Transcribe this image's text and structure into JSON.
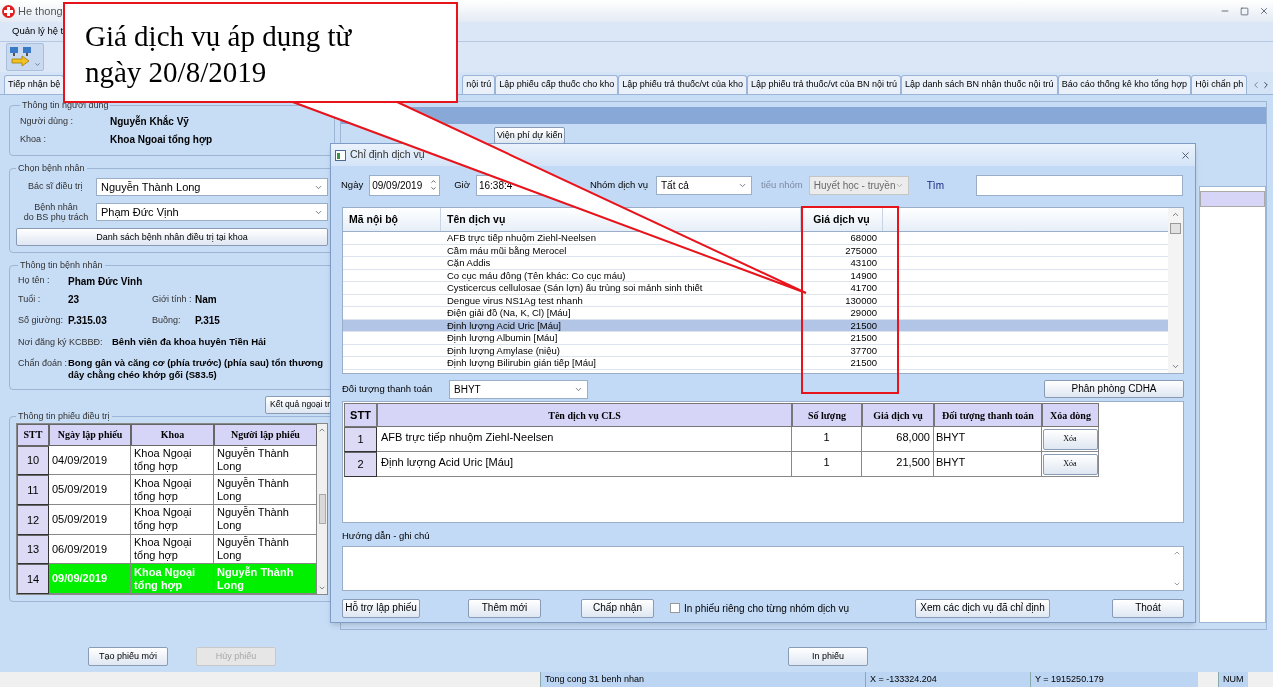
{
  "window": {
    "title": "He thong"
  },
  "menu": [
    "Quản lý hệ t"
  ],
  "tabs": [
    {
      "label": "Tiếp nhận bệ",
      "selected": false
    },
    {
      "label": "nội trú",
      "selected": false
    },
    {
      "label": "Lập phiếu cấp thuốc cho kho",
      "selected": false
    },
    {
      "label": "Lập phiếu trả thuốc/vt của kho",
      "selected": false
    },
    {
      "label": "Lập phiếu trả thuốc/vt của BN nội trú",
      "selected": false
    },
    {
      "label": "Lập danh sách BN nhận thuốc nội trú",
      "selected": false
    },
    {
      "label": "Báo cáo thống kê kho tổng hợp",
      "selected": false
    },
    {
      "label": "Hội chẩn ph",
      "selected": false
    }
  ],
  "callout": {
    "text": "Giá dịch vụ áp dụng từ ngày 20/8/2019"
  },
  "user_info": {
    "title": "Thông tin người dùng",
    "fields": [
      {
        "label": "Người dùng :",
        "value": "Nguyễn Khắc Vỹ"
      },
      {
        "label": "Khoa :",
        "value": "Khoa Ngoai tổng hợp"
      }
    ]
  },
  "patient_select": {
    "title": "Chọn bệnh nhân",
    "doctor": {
      "label": "Bác sĩ điều trị",
      "value": "Nguyễn Thành Long"
    },
    "patient": {
      "label": "Bệnh nhân\ndo BS phụ trách",
      "value": "Phạm Đức Vịnh"
    },
    "list_button": "Danh sách bệnh nhân điều trị tại khoa"
  },
  "patient_info": {
    "title": "Thông tin bệnh nhân",
    "name": {
      "label": "Họ tên :",
      "value": "Pham Đức Vinh"
    },
    "age": {
      "label": "Tuổi :",
      "value": "23"
    },
    "sex": {
      "label": "Giới tính :",
      "value": "Nam"
    },
    "bed": {
      "label": "Số giường:",
      "value": "P.315.03"
    },
    "room": {
      "label": "Buồng:",
      "value": "P.315"
    },
    "registration": {
      "label": "Nơi đăng ký KCBBĐ:",
      "value": "Bênh viên đa khoa huyên Tiền Hải"
    },
    "diagnosis": {
      "label": "Chẩn đoán :",
      "value": "Bong gân và căng cơ (phía trước) (phía sau) tổn thương dây chằng chéo khớp gối (S83.5)"
    }
  },
  "results_button": "Kết quả ngoại tr",
  "treatment_sheets": {
    "title": "Thông tin phiếu điều trị",
    "columns": [
      "STT",
      "Ngày lập phiếu",
      "Khoa",
      "Người lập phiếu"
    ],
    "rows": [
      {
        "stt": "10",
        "date": "04/09/2019",
        "dept": "Khoa Ngoại tổng hợp",
        "author": "Nguyễn Thành Long",
        "selected": false
      },
      {
        "stt": "11",
        "date": "05/09/2019",
        "dept": "Khoa Ngoại tổng hợp",
        "author": "Nguyễn Thành Long",
        "selected": false
      },
      {
        "stt": "12",
        "date": "05/09/2019",
        "dept": "Khoa Ngoại tổng hợp",
        "author": "Nguyễn Thành Long",
        "selected": false
      },
      {
        "stt": "13",
        "date": "06/09/2019",
        "dept": "Khoa Ngoại tổng hợp",
        "author": "Nguyễn Thành Long",
        "selected": false
      },
      {
        "stt": "14",
        "date": "09/09/2019",
        "dept": "Khoa Ngoại tổng hợp",
        "author": "Nguyễn Thành Long",
        "selected": true
      }
    ]
  },
  "bottom_buttons": [
    {
      "label": "Tạo phiếu mới",
      "disabled": false
    },
    {
      "label": "Hủy phiếu",
      "disabled": true
    }
  ],
  "print_button": "In phiếu",
  "estimate_button": "Viện phí dự kiến",
  "dialog": {
    "title": "Chỉ định dịch vụ",
    "date": {
      "label": "Ngày",
      "value": "09/09/2019"
    },
    "time": {
      "label": "Giờ",
      "value": "16:38:4"
    },
    "group": {
      "label": "Nhóm dịch vụ",
      "value": "Tất cả"
    },
    "subgroup": {
      "label": "tiểu nhóm",
      "value": "Huyết học - truyền",
      "disabled": true
    },
    "search": {
      "label": "Tìm"
    },
    "services": {
      "columns": [
        "Mã nội bộ",
        "Tên dịch vụ",
        "Giá dịch vụ"
      ],
      "rows": [
        {
          "name": "AFB trực tiếp nhuộm Ziehl-Neelsen",
          "price": "68000",
          "selected": false
        },
        {
          "name": "Cầm máu mũi bằng Merocel",
          "price": "275000",
          "selected": false
        },
        {
          "name": "Cặn Addis",
          "price": "43100",
          "selected": false
        },
        {
          "name": "Co cục máu đông (Tên khác: Co cục máu)",
          "price": "14900",
          "selected": false
        },
        {
          "name": "Cysticercus cellulosae (Sán lợn) ấu trùng soi mảnh sinh thiết",
          "price": "41700",
          "selected": false
        },
        {
          "name": "Dengue virus NS1Ag test nhanh",
          "price": "130000",
          "selected": false
        },
        {
          "name": "Điện giải đồ (Na, K, Cl) [Máu]",
          "price": "29000",
          "selected": false
        },
        {
          "name": "Định lượng Acid Uric [Máu]",
          "price": "21500",
          "selected": true
        },
        {
          "name": "Định lượng Albumin [Máu]",
          "price": "21500",
          "selected": false
        },
        {
          "name": "Định lượng Amylase (niệu)",
          "price": "37700",
          "selected": false
        },
        {
          "name": "Định lượng Bilirubin gián tiếp [Máu]",
          "price": "21500",
          "selected": false
        }
      ]
    },
    "payer": {
      "label": "Đối tượng thanh toán",
      "value": "BHYT"
    },
    "cdha_button": "Phân phòng CDHA",
    "chosen": {
      "columns": [
        "STT",
        "Tên dịch vụ CLS",
        "Số lượng",
        "Giá dịch vụ",
        "Đối tượng thanh toán",
        "Xóa dòng"
      ],
      "rows": [
        {
          "stt": "1",
          "name": "AFB trực tiếp nhuộm Ziehl-Neelsen",
          "qty": "1",
          "price": "68,000",
          "payer": "BHYT",
          "action": "Xóa"
        },
        {
          "stt": "2",
          "name": "Định lượng Acid Uric [Máu]",
          "qty": "1",
          "price": "21,500",
          "payer": "BHYT",
          "action": "Xóa"
        }
      ]
    },
    "notes": {
      "label": "Hướng dẫn - ghi chú"
    },
    "buttons": [
      "Hỗ trợ lập phiếu",
      "Thêm mới",
      "Chấp nhận"
    ],
    "separate_print": {
      "label": "In phiếu riêng cho từng nhóm dịch vụ",
      "checked": false
    },
    "view_button": "Xem các dịch vụ đã chỉ định",
    "exit_button": "Thoát"
  },
  "status_bar": [
    "Tong cong 31 benh nhan",
    "X = -133324.204",
    "Y = 1915250.179",
    "NUM"
  ]
}
